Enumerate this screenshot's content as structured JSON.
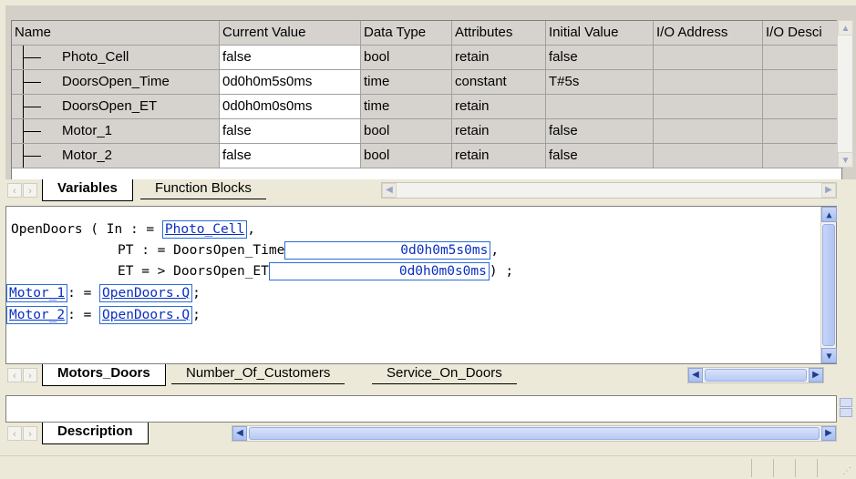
{
  "variables_grid": {
    "columns": [
      "Name",
      "Current Value",
      "Data Type",
      "Attributes",
      "Initial Value",
      "I/O Address",
      "I/O Desci"
    ],
    "rows": [
      {
        "name": "Photo_Cell",
        "current": "false",
        "type": "bool",
        "attributes": "retain",
        "initial": "false",
        "io_address": "",
        "io_desc": ""
      },
      {
        "name": "DoorsOpen_Time",
        "current": "0d0h0m5s0ms",
        "type": "time",
        "attributes": "constant",
        "initial": "T#5s",
        "io_address": "",
        "io_desc": ""
      },
      {
        "name": "DoorsOpen_ET",
        "current": "0d0h0m0s0ms",
        "type": "time",
        "attributes": "retain",
        "initial": "",
        "io_address": "",
        "io_desc": ""
      },
      {
        "name": "Motor_1",
        "current": "false",
        "type": "bool",
        "attributes": "retain",
        "initial": "false",
        "io_address": "",
        "io_desc": ""
      },
      {
        "name": "Motor_2",
        "current": "false",
        "type": "bool",
        "attributes": "retain",
        "initial": "false",
        "io_address": "",
        "io_desc": ""
      }
    ],
    "tabs": [
      "Variables",
      "Function Blocks"
    ],
    "active_tab": "Variables"
  },
  "code_editor": {
    "line1": {
      "prefix": "OpenDoors ( In : = ",
      "var": "Photo_Cell",
      "suffix": ","
    },
    "line2": {
      "prefix": "PT : = DoorsOpen_Time",
      "value": "0d0h0m5s0ms",
      "suffix": ","
    },
    "line3": {
      "prefix": "ET = > DoorsOpen_ET",
      "value": "0d0h0m0s0ms",
      "suffix": ") ;"
    },
    "line4": {
      "target": "Motor_1",
      "op": ": = ",
      "source": "OpenDoors.Q",
      "suffix": ";"
    },
    "line5": {
      "target": "Motor_2",
      "op": ": = ",
      "source": "OpenDoors.Q",
      "suffix": ";"
    },
    "tabs": [
      "Motors_Doors",
      "Number_Of_Customers",
      "Service_On_Doors"
    ],
    "active_tab": "Motors_Doors"
  },
  "description": {
    "tabs": [
      "Description"
    ],
    "active_tab": "Description"
  },
  "colors": {
    "link_blue": "#0a2fc0",
    "box_border": "#2a6bd8",
    "window_bg": "#ece9d8",
    "grid_gray": "#d6d3ce"
  }
}
